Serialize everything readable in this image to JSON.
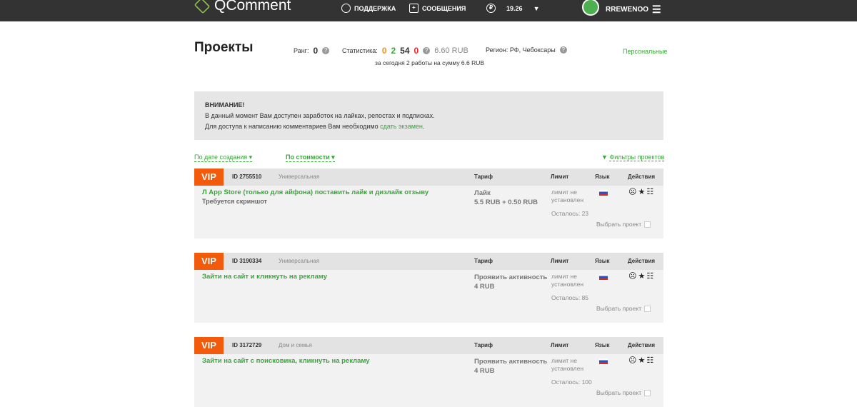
{
  "header": {
    "logo": "QComment",
    "support": "ПОДДЕРЖКА",
    "messages": "СООБЩЕНИЯ",
    "balance": "19.26",
    "username": "RREWENOO"
  },
  "page": {
    "title": "Проекты",
    "rank_label": "Ранг:",
    "rank": "0",
    "stats_label": "Статистика:",
    "stats": [
      "0",
      "2",
      "54",
      "0"
    ],
    "stats_sum": "6.60 RUB",
    "today": "за сегодня 2 работы на сумму 6.6 RUB",
    "region": "Регион: РФ, Чебоксары",
    "personal": "Персональные"
  },
  "notice": {
    "title": "ВНИМАНИЕ!",
    "line1": "В данный момент Вам доступен заработок на лайках, репостах и подписках.",
    "line2_pre": "Для доступа к написанию комментариев Вам необходимо ",
    "line2_link": "сдать экзамен",
    "line2_post": "."
  },
  "sort": {
    "by_date": "По дате создания",
    "by_cost": "По стоимости",
    "filters": "Фильтры проектов"
  },
  "columns": {
    "tariff": "Тариф",
    "limit": "Лимит",
    "lang": "Язык",
    "actions": "Действия"
  },
  "projects": [
    {
      "badge": "VIP",
      "id": "ID 2755510",
      "category": "Универсальная",
      "title": "Л App Store (только для айфона) поставить лайк и дизлайк отзыву",
      "subtitle": "Требуется скриншот",
      "tariff": "Лайк",
      "price": "5.5 RUB + 0.50 RUB",
      "limit": "лимит не установлен",
      "left": "Осталось: 23",
      "select": "Выбрать проект"
    },
    {
      "badge": "VIP",
      "id": "ID 3190334",
      "category": "Универсальная",
      "title": "Зайти на сайт и кликнуть на рекламу",
      "subtitle": "",
      "tariff": "Проявить активность",
      "price": "4 RUB",
      "limit": "лимит не установлен",
      "left": "Осталось: 85",
      "select": "Выбрать проект"
    },
    {
      "badge": "VIP",
      "id": "ID 3172729",
      "category": "Дом и семья",
      "title": "Зайти на сайт с поисковика, кликнуть на рекламу",
      "subtitle": "",
      "tariff": "Проявить активность",
      "price": "4 RUB",
      "limit": "лимит не установлен",
      "left": "Осталось: 100",
      "select": "Выбрать проект"
    }
  ]
}
